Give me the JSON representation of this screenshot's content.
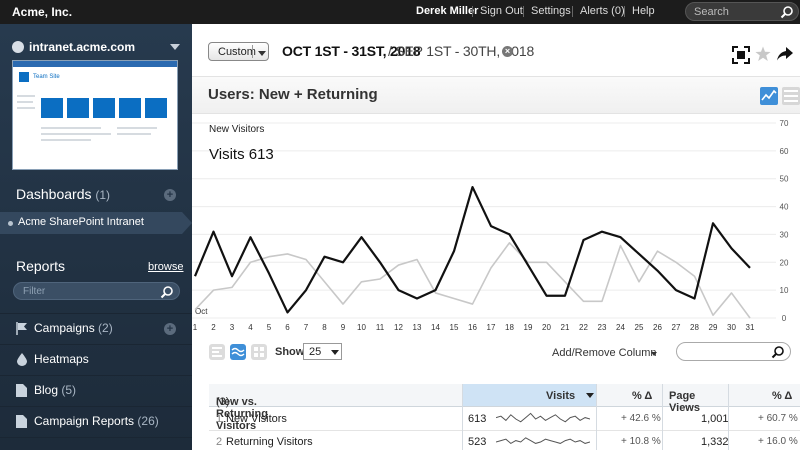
{
  "topbar": {
    "brand": "Acme, Inc.",
    "user": "Derek Miller",
    "sign_out": "Sign Out",
    "settings": "Settings",
    "alerts": "Alerts (0)",
    "help": "Help",
    "search_placeholder": "Search"
  },
  "sidebar": {
    "site": "intranet.acme.com",
    "thumb": {
      "title": "Team Site"
    },
    "dashboards_label": "Dashboards",
    "dashboards_count": "(1)",
    "dashboard_item": "Acme SharePoint Intranet",
    "reports_label": "Reports",
    "browse": "browse",
    "filter_placeholder": "Filter",
    "items": [
      {
        "label": "Campaigns",
        "count": "(2)",
        "icon": "flag-icon"
      },
      {
        "label": "Heatmaps",
        "count": "",
        "icon": "drop-icon"
      },
      {
        "label": "Blog",
        "count": "(5)",
        "icon": "document-icon"
      },
      {
        "label": "Campaign Reports",
        "count": "(26)",
        "icon": "document-icon"
      }
    ]
  },
  "header": {
    "range_type": "Custom",
    "primary_range": "OCT 1ST - 31ST, 2018",
    "compare_range": "/ SEP 1ST - 30TH, 2018",
    "report_title": "Users: New + Returning"
  },
  "chart_data": {
    "type": "line",
    "title": "New Visitors",
    "headline": "Visits 613",
    "x_first_label": "Oct",
    "categories": [
      "1",
      "2",
      "3",
      "4",
      "5",
      "6",
      "7",
      "8",
      "9",
      "10",
      "11",
      "12",
      "13",
      "14",
      "15",
      "16",
      "17",
      "18",
      "19",
      "20",
      "21",
      "22",
      "23",
      "24",
      "25",
      "26",
      "27",
      "28",
      "29",
      "30",
      "31"
    ],
    "ylim": [
      0,
      70
    ],
    "yticks": [
      0,
      10,
      20,
      30,
      40,
      50,
      60,
      70
    ],
    "series": [
      {
        "name": "Oct",
        "color": "#111111",
        "values": [
          15,
          31,
          15,
          29,
          16,
          2,
          10,
          22,
          20,
          29,
          20,
          10,
          7,
          10,
          24,
          47,
          33,
          30,
          19,
          8,
          8,
          28,
          31,
          29,
          23,
          17,
          10,
          7,
          34,
          25,
          18
        ]
      },
      {
        "name": "Sep",
        "color": "#c8c8c8",
        "values": [
          3,
          10,
          11,
          20,
          22,
          23,
          21,
          13,
          5,
          13,
          14,
          19,
          21,
          9,
          7,
          5,
          18,
          27,
          20,
          20,
          13,
          6,
          6,
          26,
          13,
          24,
          20,
          15,
          1,
          9,
          0
        ]
      }
    ]
  },
  "controls": {
    "show_label": "Show",
    "show_value": "25",
    "add_remove": "Add/Remove Column"
  },
  "table": {
    "headers": {
      "dimension": "New vs. Returning Visitors",
      "dimension_count": "(3)",
      "visits": "Visits",
      "visits_pct": "% Δ",
      "pageviews": "Page Views",
      "pageviews_pct": "% Δ"
    },
    "rows": [
      {
        "num": "1",
        "label": "New Visitors",
        "visits": "613",
        "visits_pct": "+ 42.6 %",
        "pageviews": "1,001",
        "pageviews_pct": "+ 60.7 %",
        "spark": [
          0.6,
          0.7,
          0.4,
          0.8,
          0.5,
          0.3,
          0.6,
          0.9,
          0.5,
          0.7,
          0.4,
          0.6,
          0.8,
          0.5,
          0.3,
          0.6,
          0.7,
          0.4,
          0.6,
          0.5
        ]
      },
      {
        "num": "2",
        "label": "Returning Visitors",
        "visits": "523",
        "visits_pct": "+ 10.8 %",
        "pageviews": "1,332",
        "pageviews_pct": "+ 16.0 %",
        "spark": [
          0.5,
          0.6,
          0.7,
          0.4,
          0.6,
          0.5,
          0.8,
          0.6,
          0.4,
          0.5,
          0.7,
          0.6,
          0.5,
          0.4,
          0.6,
          0.7,
          0.5,
          0.6,
          0.4,
          0.5
        ]
      }
    ]
  }
}
